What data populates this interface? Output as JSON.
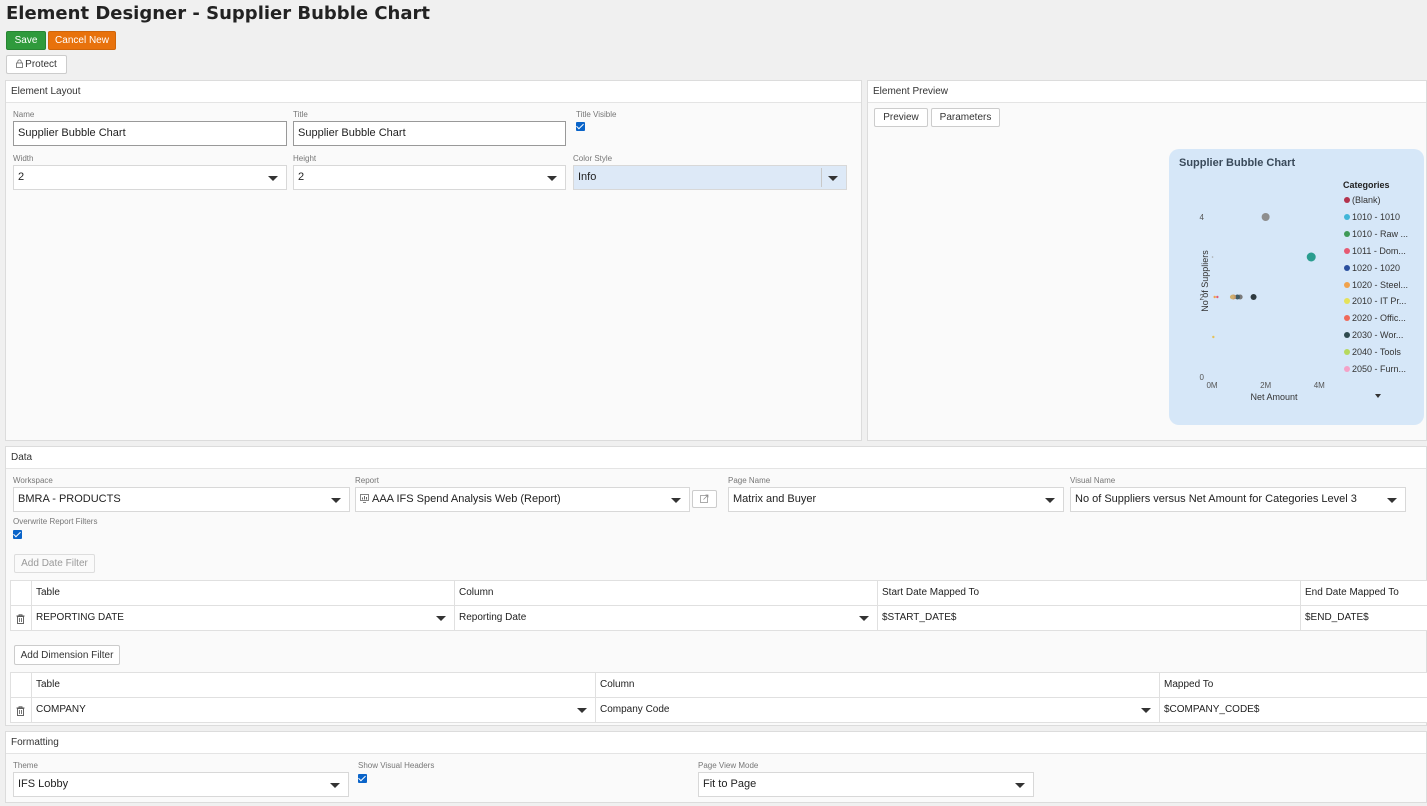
{
  "page": {
    "title": "Element Designer - Supplier Bubble Chart"
  },
  "toolbar": {
    "save_label": "Save",
    "cancel_label": "Cancel New",
    "protect_label": "Protect"
  },
  "layout": {
    "header": "Element Layout",
    "name_label": "Name",
    "name_value": "Supplier Bubble Chart",
    "title_label": "Title",
    "title_value": "Supplier Bubble Chart",
    "title_visible_label": "Title Visible",
    "width_label": "Width",
    "width_value": "2",
    "height_label": "Height",
    "height_value": "2",
    "color_style_label": "Color Style",
    "color_style_value": "Info"
  },
  "preview": {
    "header": "Element Preview",
    "preview_tab": "Preview",
    "parameters_tab": "Parameters",
    "chart_title": "Supplier Bubble Chart",
    "legend_title": "Categories",
    "legend": [
      {
        "label": "(Blank)",
        "color": "#b3334d"
      },
      {
        "label": "1010 - 1010",
        "color": "#41b6d8"
      },
      {
        "label": "1010 - Raw ...",
        "color": "#3f9a57"
      },
      {
        "label": "1011 - Dom...",
        "color": "#e65a73"
      },
      {
        "label": "1020 - 1020",
        "color": "#2a4f9e"
      },
      {
        "label": "1020 - Steel...",
        "color": "#f0a24c"
      },
      {
        "label": "2010 - IT Pr...",
        "color": "#e5e25a"
      },
      {
        "label": "2020 - Offic...",
        "color": "#ef6a5a"
      },
      {
        "label": "2030 - Wor...",
        "color": "#2e4a4f"
      },
      {
        "label": "2040 - Tools",
        "color": "#b6d95e"
      },
      {
        "label": "2050 - Furn...",
        "color": "#f4a2c7"
      }
    ]
  },
  "chart_data": {
    "type": "scatter",
    "title": "Supplier Bubble Chart",
    "xlabel": "Net Amount",
    "ylabel": "No of Suppliers",
    "x_ticks": [
      "0M",
      "2M",
      "4M"
    ],
    "y_ticks": [
      "0",
      "2",
      "4"
    ],
    "xlim": [
      0,
      4.4
    ],
    "ylim": [
      0,
      4.4
    ],
    "grid": false,
    "legend_position": "right",
    "points": [
      {
        "x": 2.0,
        "y": 4,
        "r": 4,
        "color": "#8e8e8e"
      },
      {
        "x": 3.7,
        "y": 3,
        "r": 4.5,
        "color": "#2a9d8f"
      },
      {
        "x": 1.55,
        "y": 2,
        "r": 3,
        "color": "#2e3a3f"
      },
      {
        "x": 1.05,
        "y": 2,
        "r": 2.5,
        "color": "#7a7a7a"
      },
      {
        "x": 0.95,
        "y": 2,
        "r": 2.5,
        "color": "#3f5a66"
      },
      {
        "x": 0.8,
        "y": 2,
        "r": 2.5,
        "color": "#c89a6a"
      },
      {
        "x": 0.75,
        "y": 2,
        "r": 2.2,
        "color": "#d0b070"
      },
      {
        "x": 0.2,
        "y": 2,
        "r": 1.2,
        "color": "#e65a73"
      },
      {
        "x": 0.1,
        "y": 2,
        "r": 1.2,
        "color": "#f0a24c"
      },
      {
        "x": 0.05,
        "y": 1,
        "r": 1.2,
        "color": "#e5c25a"
      },
      {
        "x": 0.02,
        "y": 3,
        "r": 0.8,
        "color": "#aaaaaa"
      }
    ]
  },
  "data": {
    "header": "Data",
    "workspace_label": "Workspace",
    "workspace_value": "BMRA - PRODUCTS",
    "report_label": "Report",
    "report_value": "AAA IFS Spend Analysis Web (Report)",
    "page_name_label": "Page Name",
    "page_name_value": "Matrix and Buyer",
    "visual_name_label": "Visual Name",
    "visual_name_value": "No of Suppliers versus Net Amount for Categories Level 3",
    "overwrite_label": "Overwrite Report Filters",
    "add_date_filter": "Add Date Filter",
    "date_grid": {
      "headers": [
        "Table",
        "Column",
        "Start Date Mapped To",
        "End Date Mapped To"
      ],
      "row": [
        "REPORTING DATE",
        "Reporting Date",
        "$START_DATE$",
        "$END_DATE$"
      ]
    },
    "add_dimension_filter": "Add Dimension Filter",
    "dim_grid": {
      "headers": [
        "Table",
        "Column",
        "Mapped To"
      ],
      "row": [
        "COMPANY",
        "Company Code",
        "$COMPANY_CODE$"
      ]
    }
  },
  "formatting": {
    "header": "Formatting",
    "theme_label": "Theme",
    "theme_value": "IFS Lobby",
    "show_headers_label": "Show Visual Headers",
    "view_mode_label": "Page View Mode",
    "view_mode_value": "Fit to Page"
  }
}
